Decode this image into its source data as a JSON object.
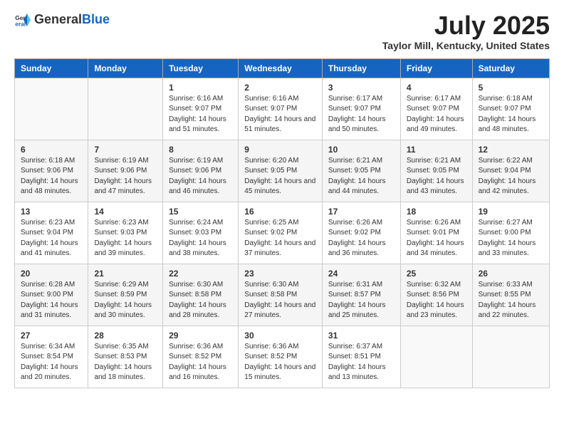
{
  "header": {
    "logo_general": "General",
    "logo_blue": "Blue",
    "title": "July 2025",
    "subtitle": "Taylor Mill, Kentucky, United States"
  },
  "calendar": {
    "days_of_week": [
      "Sunday",
      "Monday",
      "Tuesday",
      "Wednesday",
      "Thursday",
      "Friday",
      "Saturday"
    ],
    "weeks": [
      [
        {
          "day": "",
          "info": ""
        },
        {
          "day": "",
          "info": ""
        },
        {
          "day": "1",
          "info": "Sunrise: 6:16 AM\nSunset: 9:07 PM\nDaylight: 14 hours and 51 minutes."
        },
        {
          "day": "2",
          "info": "Sunrise: 6:16 AM\nSunset: 9:07 PM\nDaylight: 14 hours and 51 minutes."
        },
        {
          "day": "3",
          "info": "Sunrise: 6:17 AM\nSunset: 9:07 PM\nDaylight: 14 hours and 50 minutes."
        },
        {
          "day": "4",
          "info": "Sunrise: 6:17 AM\nSunset: 9:07 PM\nDaylight: 14 hours and 49 minutes."
        },
        {
          "day": "5",
          "info": "Sunrise: 6:18 AM\nSunset: 9:07 PM\nDaylight: 14 hours and 48 minutes."
        }
      ],
      [
        {
          "day": "6",
          "info": "Sunrise: 6:18 AM\nSunset: 9:06 PM\nDaylight: 14 hours and 48 minutes."
        },
        {
          "day": "7",
          "info": "Sunrise: 6:19 AM\nSunset: 9:06 PM\nDaylight: 14 hours and 47 minutes."
        },
        {
          "day": "8",
          "info": "Sunrise: 6:19 AM\nSunset: 9:06 PM\nDaylight: 14 hours and 46 minutes."
        },
        {
          "day": "9",
          "info": "Sunrise: 6:20 AM\nSunset: 9:05 PM\nDaylight: 14 hours and 45 minutes."
        },
        {
          "day": "10",
          "info": "Sunrise: 6:21 AM\nSunset: 9:05 PM\nDaylight: 14 hours and 44 minutes."
        },
        {
          "day": "11",
          "info": "Sunrise: 6:21 AM\nSunset: 9:05 PM\nDaylight: 14 hours and 43 minutes."
        },
        {
          "day": "12",
          "info": "Sunrise: 6:22 AM\nSunset: 9:04 PM\nDaylight: 14 hours and 42 minutes."
        }
      ],
      [
        {
          "day": "13",
          "info": "Sunrise: 6:23 AM\nSunset: 9:04 PM\nDaylight: 14 hours and 41 minutes."
        },
        {
          "day": "14",
          "info": "Sunrise: 6:23 AM\nSunset: 9:03 PM\nDaylight: 14 hours and 39 minutes."
        },
        {
          "day": "15",
          "info": "Sunrise: 6:24 AM\nSunset: 9:03 PM\nDaylight: 14 hours and 38 minutes."
        },
        {
          "day": "16",
          "info": "Sunrise: 6:25 AM\nSunset: 9:02 PM\nDaylight: 14 hours and 37 minutes."
        },
        {
          "day": "17",
          "info": "Sunrise: 6:26 AM\nSunset: 9:02 PM\nDaylight: 14 hours and 36 minutes."
        },
        {
          "day": "18",
          "info": "Sunrise: 6:26 AM\nSunset: 9:01 PM\nDaylight: 14 hours and 34 minutes."
        },
        {
          "day": "19",
          "info": "Sunrise: 6:27 AM\nSunset: 9:00 PM\nDaylight: 14 hours and 33 minutes."
        }
      ],
      [
        {
          "day": "20",
          "info": "Sunrise: 6:28 AM\nSunset: 9:00 PM\nDaylight: 14 hours and 31 minutes."
        },
        {
          "day": "21",
          "info": "Sunrise: 6:29 AM\nSunset: 8:59 PM\nDaylight: 14 hours and 30 minutes."
        },
        {
          "day": "22",
          "info": "Sunrise: 6:30 AM\nSunset: 8:58 PM\nDaylight: 14 hours and 28 minutes."
        },
        {
          "day": "23",
          "info": "Sunrise: 6:30 AM\nSunset: 8:58 PM\nDaylight: 14 hours and 27 minutes."
        },
        {
          "day": "24",
          "info": "Sunrise: 6:31 AM\nSunset: 8:57 PM\nDaylight: 14 hours and 25 minutes."
        },
        {
          "day": "25",
          "info": "Sunrise: 6:32 AM\nSunset: 8:56 PM\nDaylight: 14 hours and 23 minutes."
        },
        {
          "day": "26",
          "info": "Sunrise: 6:33 AM\nSunset: 8:55 PM\nDaylight: 14 hours and 22 minutes."
        }
      ],
      [
        {
          "day": "27",
          "info": "Sunrise: 6:34 AM\nSunset: 8:54 PM\nDaylight: 14 hours and 20 minutes."
        },
        {
          "day": "28",
          "info": "Sunrise: 6:35 AM\nSunset: 8:53 PM\nDaylight: 14 hours and 18 minutes."
        },
        {
          "day": "29",
          "info": "Sunrise: 6:36 AM\nSunset: 8:52 PM\nDaylight: 14 hours and 16 minutes."
        },
        {
          "day": "30",
          "info": "Sunrise: 6:36 AM\nSunset: 8:52 PM\nDaylight: 14 hours and 15 minutes."
        },
        {
          "day": "31",
          "info": "Sunrise: 6:37 AM\nSunset: 8:51 PM\nDaylight: 14 hours and 13 minutes."
        },
        {
          "day": "",
          "info": ""
        },
        {
          "day": "",
          "info": ""
        }
      ]
    ]
  }
}
